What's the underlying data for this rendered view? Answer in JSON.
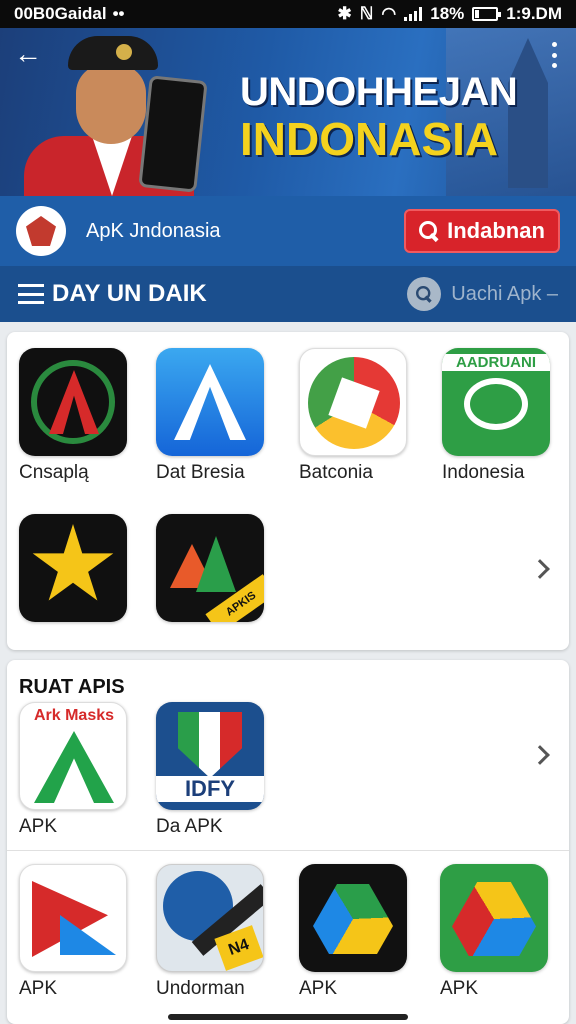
{
  "status_bar": {
    "left_text": "00B0Gaidal",
    "indicators": "••",
    "network": "ℕ",
    "battery_text": "18%",
    "battery_level": 0.18,
    "time": "1:9.DM"
  },
  "banner": {
    "title_line1": "UNDOHHEJAN",
    "title_line2": "INDONASIA"
  },
  "brand": {
    "name": "ApK Jndonasia",
    "button_label": "Indabnan"
  },
  "nav": {
    "title": "DAY UN DAIK",
    "search_placeholder": "Uachi Apk –"
  },
  "apps_section_1": {
    "rows": [
      [
        {
          "label": "Cnsaplą",
          "icon": "red-a-star-app-icon"
        },
        {
          "label": "Dat Bresia",
          "icon": "blue-a-app-icon"
        },
        {
          "label": "Batconia",
          "icon": "color-ring-app-icon"
        },
        {
          "label": "Indonesia",
          "icon": "green-chat-app-icon",
          "icon_text": "AADRUANI"
        }
      ],
      [
        {
          "label": "",
          "icon": "yellow-star-app-icon"
        },
        {
          "label": "",
          "icon": "triangles-app-icon",
          "icon_text": "APKIS"
        }
      ]
    ]
  },
  "apps_section_2": {
    "title": "RUAT APIS",
    "rows": [
      [
        {
          "label": "APK",
          "icon": "green-a-app-icon",
          "icon_text": "Ark Masks"
        },
        {
          "label": "Da APK",
          "icon": "shield-app-icon",
          "icon_text": "IDFY"
        }
      ],
      [
        {
          "label": "APK",
          "icon": "red-triangle-app-icon"
        },
        {
          "label": "Undorman",
          "icon": "pen-app-icon",
          "icon_text": "N4"
        },
        {
          "label": "APK",
          "icon": "drive-dark-app-icon"
        },
        {
          "label": "APK",
          "icon": "drive-green-app-icon"
        }
      ]
    ]
  },
  "colors": {
    "banner_blue": "#1f5ea8",
    "nav_blue": "#1b4f8e",
    "accent_red": "#d8232a",
    "title_yellow": "#f4d21e"
  }
}
